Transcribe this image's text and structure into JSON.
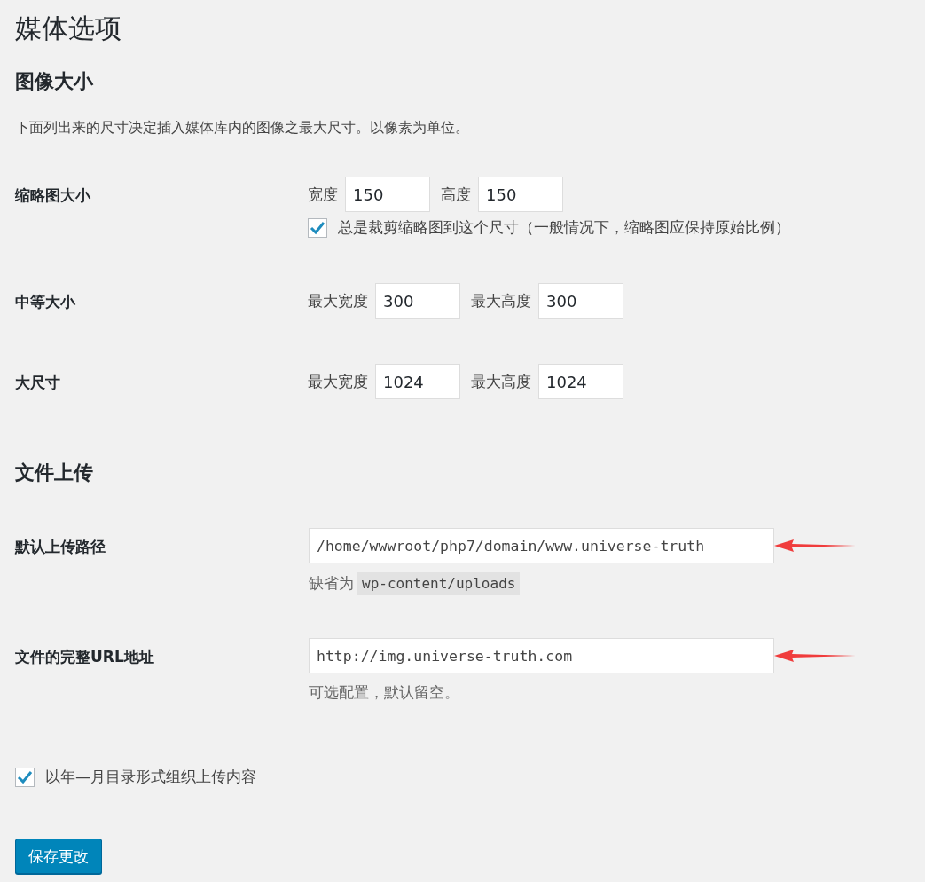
{
  "page_title": "媒体选项",
  "image_sizes": {
    "heading": "图像大小",
    "description": "下面列出来的尺寸决定插入媒体库内的图像之最大尺寸。以像素为单位。",
    "rows": [
      {
        "label": "缩略图大小",
        "fields": [
          {
            "label": "宽度",
            "value": "150"
          },
          {
            "label": "高度",
            "value": "150"
          }
        ],
        "checkbox": {
          "label": "总是裁剪缩略图到这个尺寸（一般情况下，缩略图应保持原始比例）",
          "checked": true
        }
      },
      {
        "label": "中等大小",
        "fields": [
          {
            "label": "最大宽度",
            "value": "300"
          },
          {
            "label": "最大高度",
            "value": "300"
          }
        ]
      },
      {
        "label": "大尺寸",
        "fields": [
          {
            "label": "最大宽度",
            "value": "1024"
          },
          {
            "label": "最大高度",
            "value": "1024"
          }
        ]
      }
    ]
  },
  "uploads": {
    "heading": "文件上传",
    "rows": [
      {
        "label": "默认上传路径",
        "value": "/home/wwwroot/php7/domain/www.universe-truth",
        "arrow": true,
        "hint": "缺省为",
        "hint_code": "wp-content/uploads"
      },
      {
        "label": "文件的完整URL地址",
        "value": "http://img.universe-truth.com",
        "arrow": true,
        "hint": "可选配置，默认留空。"
      }
    ],
    "organize": {
      "label": "以年—月目录形式组织上传内容",
      "checked": true
    }
  },
  "save_button": "保存更改"
}
